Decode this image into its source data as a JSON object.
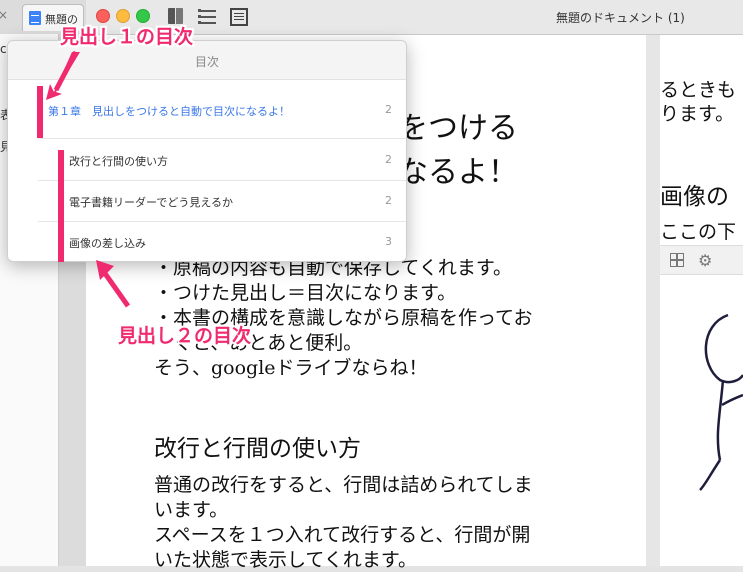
{
  "browser": {
    "tab_title": "無題のドキ",
    "tab_close": "×",
    "left_fragments": [
      "co",
      "表",
      "見"
    ]
  },
  "window": {
    "title": "無題のドキュメント (1)"
  },
  "document": {
    "title_line1_fragment": "をつける",
    "title_line2_fragment": "なるよ！",
    "bullets": [
      "・原稿の内容も自動で保存してくれます。",
      "・つけた見出し＝目次になります。",
      "・本書の構成を意識しながら原稿を作ってお",
      "　くと、あとあと便利。"
    ],
    "closing": "そう、googleドライブならね！",
    "section_heading": "改行と行間の使い方",
    "paragraph_lines": [
      "普通の改行をすると、行間は詰められてしま",
      "います。",
      "スペースを１つ入れて改行すると、行間が開",
      "いた状態で表示してくれます。"
    ]
  },
  "page2": {
    "lines": [
      "るときも",
      "ります。"
    ],
    "heading": "画像の",
    "subline": "ここの下"
  },
  "toc": {
    "title": "目次",
    "items": [
      {
        "label": "第１章　見出しをつけると自動で目次になるよ！",
        "page": "2",
        "level": 1
      },
      {
        "label": "改行と行間の使い方",
        "page": "2",
        "level": 2
      },
      {
        "label": "電子書籍リーダーでどう見えるか",
        "page": "2",
        "level": 2
      },
      {
        "label": "画像の差し込み",
        "page": "3",
        "level": 2
      }
    ]
  },
  "annotations": {
    "h1_label": "見出し１の目次",
    "h2_label": "見出し２の目次",
    "color": "#f02a6f"
  }
}
